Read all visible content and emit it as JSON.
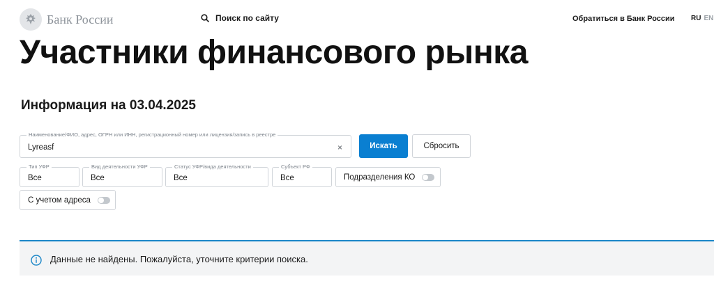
{
  "header": {
    "logo_text": "Банк России",
    "search_label": "Поиск по сайту",
    "contact_label": "Обратиться в Банк России",
    "lang_ru": "RU",
    "lang_en": "EN"
  },
  "page": {
    "title": "Участники финансового рынка",
    "info_heading": "Информация на 03.04.2025"
  },
  "search": {
    "label": "Наименование/ФИО, адрес, ОГРН или ИНН, регистрационный номер или лицензия/запись в реестре",
    "value": "Lyreasf",
    "clear_symbol": "×",
    "submit_label": "Искать",
    "reset_label": "Сбросить"
  },
  "filters": [
    {
      "label": "Тип УФР",
      "value": "Все"
    },
    {
      "label": "Вид деятельности УФР",
      "value": "Все"
    },
    {
      "label": "Статус УФР/вида деятельности",
      "value": "Все"
    },
    {
      "label": "Субъект РФ",
      "value": "Все"
    }
  ],
  "toggles": {
    "branches_label": "Подразделения КО",
    "branches_on": false,
    "address_label": "С учетом адреса",
    "address_on": false
  },
  "alert": {
    "text": "Данные не найдены. Пожалуйста, уточните критерии поиска.",
    "accent_color": "#1a86c8"
  },
  "icons": {
    "logo": "emblem-icon",
    "search": "search-icon",
    "info": "info-icon"
  },
  "colors": {
    "primary": "#0a7fd1",
    "text": "#1a1a1a",
    "muted": "#8d939a"
  }
}
